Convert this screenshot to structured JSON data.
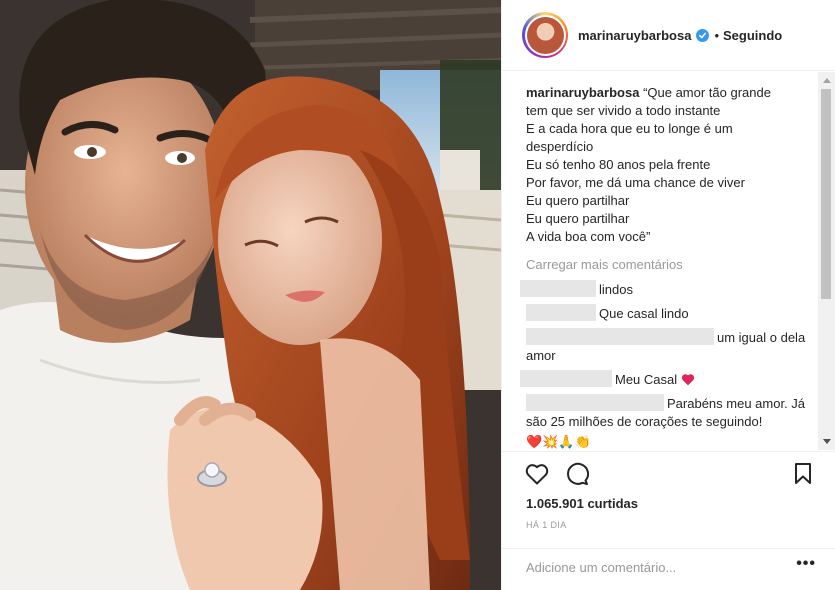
{
  "header": {
    "username": "marinaruybarbosa",
    "separator": "•",
    "follow_status": "Seguindo"
  },
  "caption": {
    "username": "marinaruybarbosa",
    "lines": [
      "“Que amor tão grande",
      "tem que ser vivido a todo instante",
      "E a cada hora que eu to longe é um",
      "desperdício",
      "Eu só tenho 80 anos pela frente",
      "Por favor, me dá uma chance de viver",
      "Eu quero partilhar",
      "Eu quero partilhar",
      "A vida boa com você”"
    ]
  },
  "load_more": "Carregar mais comentários",
  "comments": [
    {
      "text": "lindos"
    },
    {
      "text": "Que casal lindo"
    },
    {
      "text": "um igual o dela amor"
    },
    {
      "text": "Meu Casal"
    },
    {
      "text": "Parabéns meu amor. Já são 25 milhões de corações te seguindo!"
    }
  ],
  "emoji_line": "❤️💥🙏👏",
  "likes": "1.065.901 curtidas",
  "time": "HÁ 1 DIA",
  "add_comment": {
    "placeholder": "Adicione um comentário..."
  },
  "more_options": "•••",
  "colors": {
    "verified": "#3897f0",
    "muted": "#999999",
    "text": "#262626",
    "heart": "#ed4956"
  },
  "icons": [
    "heart-icon",
    "comment-icon",
    "bookmark-icon",
    "verified-badge-icon",
    "more-options-icon"
  ]
}
